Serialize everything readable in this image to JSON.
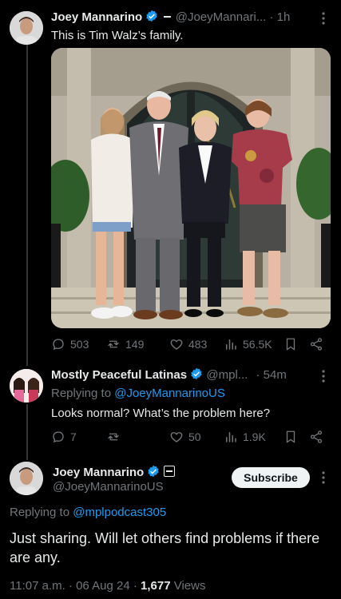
{
  "tweet1": {
    "author_name": "Joey Mannarino",
    "handle": "@JoeyMannari...",
    "time": "· 1h",
    "text": "This is Tim Walz’s family.",
    "metrics": {
      "replies": "503",
      "retweets": "149",
      "likes": "483",
      "views": "56.5K"
    }
  },
  "tweet2": {
    "author_name": "Mostly Peaceful Latinas",
    "handle": "@mpl...",
    "time": "· 54m",
    "replying_prefix": "Replying to",
    "replying_handle": "@JoeyMannarinoUS",
    "text": "Looks normal? What’s the problem here?",
    "metrics": {
      "replies": "7",
      "retweets": "",
      "likes": "50",
      "views": "1.9K"
    }
  },
  "tweet3": {
    "author_name": "Joey Mannarino",
    "handle": "@JoeyMannarinoUS",
    "subscribe_label": "Subscribe",
    "replying_prefix": "Replying to",
    "replying_handle": "@mplpodcast305",
    "text": "Just sharing. Will let others find problems if there are any.",
    "timestamp": "11:07 a.m. · 06 Aug 24 · ",
    "views_count": "1,677",
    "views_label": " Views"
  },
  "colors": {
    "accent": "#1d9bf0",
    "muted": "#71767b",
    "text": "#e7e9ea"
  }
}
